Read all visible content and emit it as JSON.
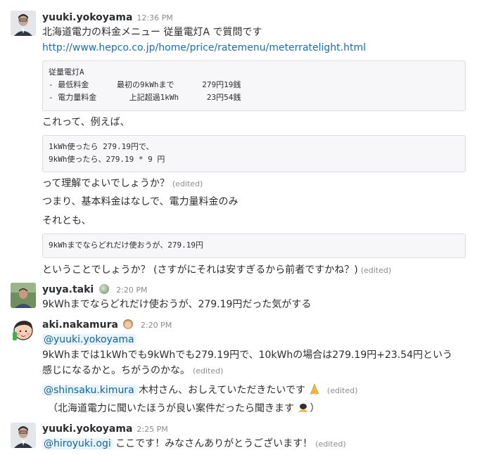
{
  "messages": [
    {
      "user": "yuuki.yokoyama",
      "time": "12:36 PM",
      "lines": [
        "北海道電力の料金メニュー 従量電灯A で質問です",
        "http://www.hepco.co.jp/home/price/ratemenu/meterratelight.html"
      ],
      "code1": "従量電灯A\n- 最低料金      最初の9kWhまで      279円19銭\n- 電力量料金       上記超過1kWh      23円54銭",
      "line3": "これって、例えば、",
      "code2": "1kWh使ったら 279.19円で、\n9kWh使ったら、279.19 * 9 円",
      "line4": "って理解でよいでしょうか？",
      "line5": "つまり、基本料金はなしで、電力量料金のみ",
      "line6": "それとも、",
      "code3": "9kWhまでならどれだけ使おうが、279.19円",
      "line7": "ということでしょうか？ (さすがにそれは安すぎるから前者ですかね？)"
    },
    {
      "user": "yuya.taki",
      "time": "2:20 PM",
      "text": "9kWhまでならどれだけ使おうが、279.19円だった気がする"
    },
    {
      "user": "aki.nakamura",
      "time": "2:20 PM",
      "mention1": "@yuuki.yokoyama",
      "text1": "9kWhまでは1kWhでも9kWhでも279.19円で、10kWhの場合は279.19円+23.54円という",
      "text2": "感じになるかと。ちがうのかな。",
      "mention2": "@shinsaku.kimura",
      "text3": " 木村さん、おしえていただきたいです",
      "text4": "（北海道電力に聞いたほうが良い案件だったら聞きます",
      "text4_end": "）"
    },
    {
      "user": "yuuki.yokoyama",
      "time": "2:25 PM",
      "mention": "@hiroyuki.ogi",
      "text": " ここです！みなさんありがとうございます！"
    }
  ],
  "edited_label": "(edited)",
  "icons": {
    "status_globe": "globe-status-icon",
    "status_monkey": "see-no-evil-monkey-icon",
    "pray": "folded-hands-icon",
    "bow": "bowing-person-icon"
  },
  "colors": {
    "link": "#1a6fb8",
    "mention_bg": "#e8f3fb",
    "code_bg": "#f7f7f9",
    "muted": "#8b8c90"
  }
}
